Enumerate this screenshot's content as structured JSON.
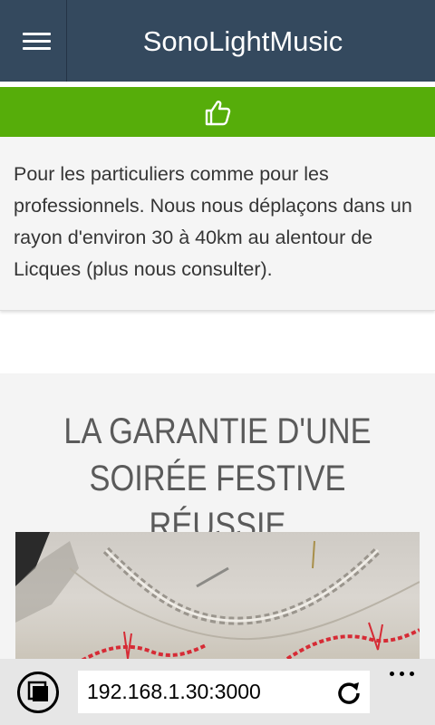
{
  "header": {
    "brand": "SonoLightMusic",
    "menu_icon": "hamburger-menu-icon",
    "color": "#34495e"
  },
  "like_bar": {
    "icon": "thumbs-up-icon",
    "color": "#56ad0a"
  },
  "info": {
    "text": "Pour les particuliers comme pour les professionnels. Nous nous déplaçons dans un rayon d'environ 30 à 40km au alentour de Licques (plus nous consulter)."
  },
  "section": {
    "title_line1": "LA GARANTIE D'UNE",
    "title_line2": "SOIRÉE FESTIVE RÉUSSIE"
  },
  "browser": {
    "url": "192.168.1.30:3000",
    "tabs_icon": "tabs-icon",
    "refresh_icon": "refresh-icon",
    "more_icon": "more-icon"
  }
}
